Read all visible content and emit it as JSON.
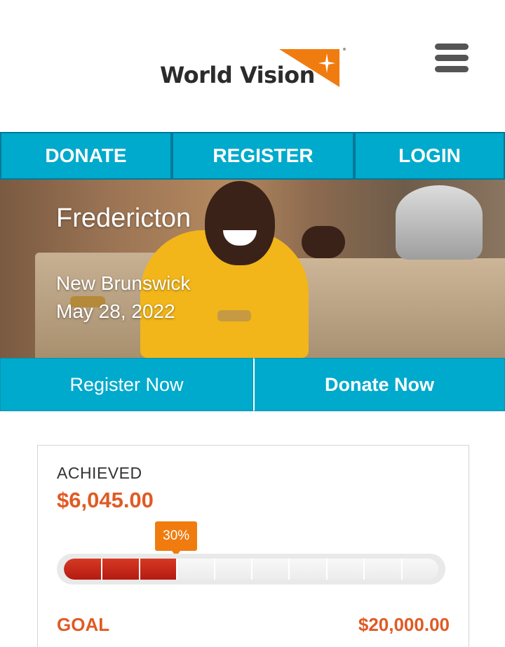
{
  "brand": {
    "name": "World Vision",
    "accent_orange": "#f07c10",
    "teal": "#00aacc"
  },
  "header": {
    "menu_icon": "hamburger-menu-icon"
  },
  "nav": {
    "donate": "DONATE",
    "register": "REGISTER",
    "login": "LOGIN"
  },
  "hero": {
    "title": "Fredericton",
    "province": "New Brunswick",
    "date": "May 28, 2022"
  },
  "cta": {
    "register": "Register Now",
    "donate": "Donate Now"
  },
  "progress": {
    "achieved_label": "ACHIEVED",
    "achieved_value": "$6,045.00",
    "percent_label": "30%",
    "percent": 30,
    "segments": 10,
    "goal_label": "GOAL",
    "goal_value": "$20,000.00"
  }
}
